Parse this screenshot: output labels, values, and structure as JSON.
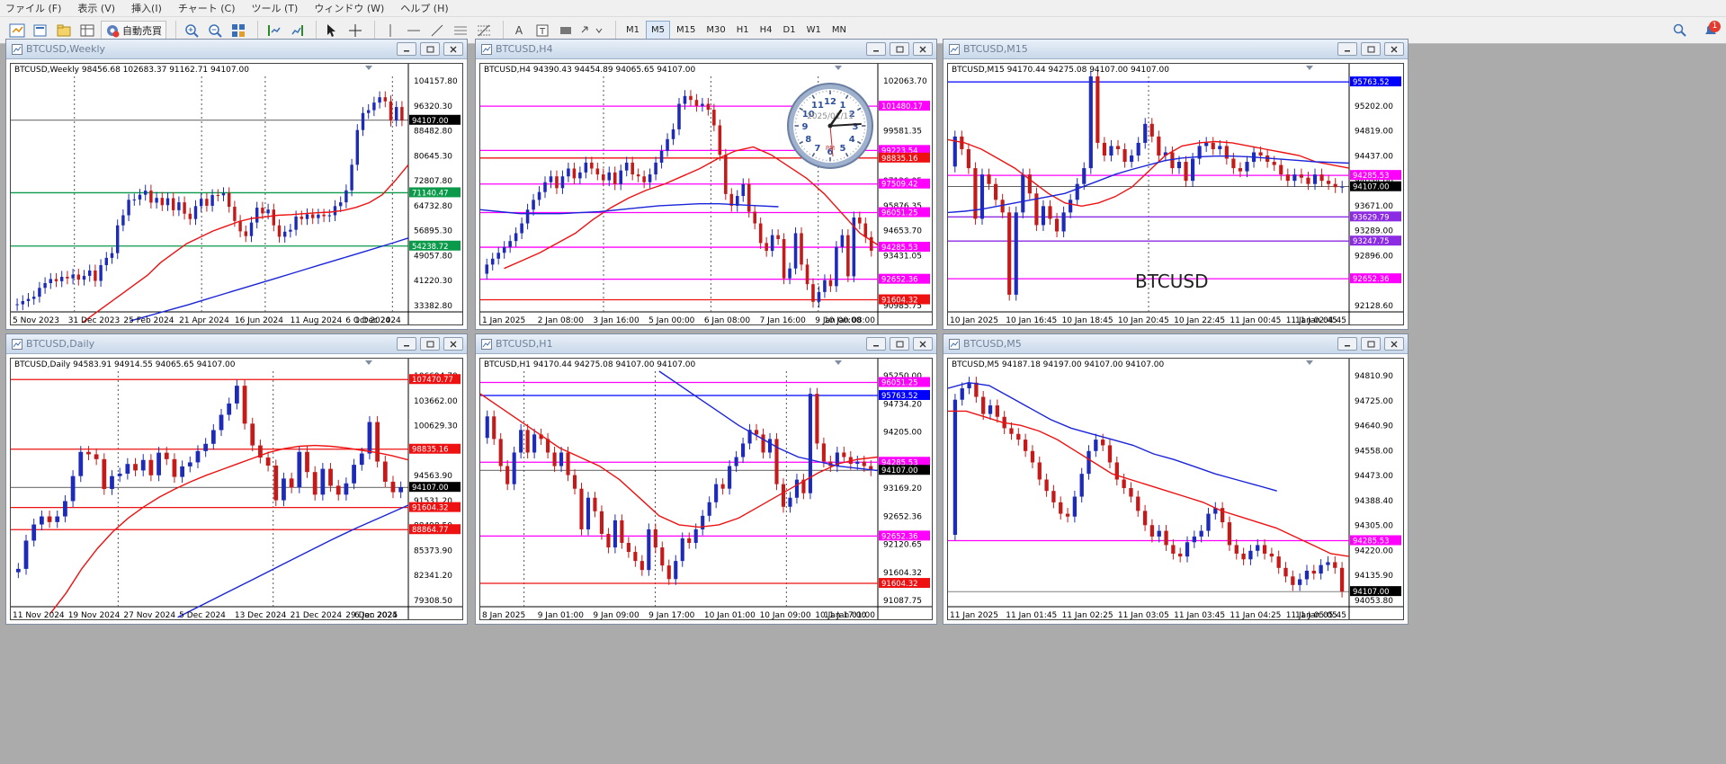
{
  "menu": [
    "ファイル (F)",
    "表示 (V)",
    "挿入(I)",
    "チャート (C)",
    "ツール (T)",
    "ウィンドウ (W)",
    "ヘルプ (H)"
  ],
  "toolbar": {
    "autotrade_label": "自動売買",
    "text_tool_label": "A",
    "timeframes": [
      "M1",
      "M5",
      "M15",
      "M30",
      "H1",
      "H4",
      "D1",
      "W1",
      "MN"
    ],
    "active_timeframe": "M5",
    "notification_count": "1"
  },
  "colors": {
    "bull": "#1d2bb8",
    "bear": "#c41a1a",
    "ma_fast": "#ee1111",
    "ma_slow": "#1a24d9",
    "magenta": "#ff00ff",
    "green": "#0a9a4a",
    "blue": "#0000ff"
  },
  "windows": [
    {
      "id": "w1",
      "title": "BTCUSD,Weekly",
      "info": "BTCUSD,Weekly  98456.68 102683.37 91162.71 94107.00",
      "price_labels": [
        "104157.80",
        "96320.30",
        "88482.80",
        "80645.30",
        "72807.80",
        "64732.80",
        "56895.30",
        "49057.80",
        "41220.30",
        "33382.80"
      ],
      "ymin": 33382.8,
      "ymax": 108000,
      "time_labels": [
        "5 Nov 2023",
        "31 Dec 2023",
        "25 Feb 2024",
        "21 Apr 2024",
        "16 Jun 2024",
        "11 Aug 2024",
        "6 Oct 2024",
        "1 Dec 2024"
      ],
      "vlines": [
        0.16,
        0.48,
        0.64,
        0.96
      ],
      "levels": [
        {
          "value": 94107.0,
          "label": "94107.00",
          "color": "#000000",
          "thin": true
        },
        {
          "value": 71140.47,
          "label": "71140.47",
          "color": "#0a9a4a"
        },
        {
          "value": 54238.72,
          "label": "54238.72",
          "color": "#0a9a4a"
        }
      ],
      "candles": [
        35800,
        36800,
        37500,
        38200,
        41000,
        42500,
        43800,
        43100,
        44500,
        44000,
        45200,
        43600,
        44800,
        46500,
        43200,
        48200,
        50500,
        52000,
        60800,
        64000,
        68900,
        69000,
        70500,
        71800,
        68000,
        69500,
        67200,
        69400,
        65600,
        68100,
        64500,
        62800,
        66900,
        69200,
        67000,
        70400,
        70300,
        71000,
        66700,
        62200,
        58900,
        57400,
        61700,
        66400,
        64600,
        65800,
        60800,
        57200,
        58800,
        59400,
        63600,
        62800,
        64300,
        63100,
        64200,
        63700,
        64000,
        66900,
        68100,
        71900,
        80000,
        91000,
        96400,
        97300,
        99700,
        101400,
        100100,
        94000,
        98300,
        94107
      ],
      "ma_fast": [
        30000,
        33000,
        36000,
        39000,
        42000,
        45000,
        49000,
        52000,
        55000,
        57000,
        59000,
        60500,
        62000,
        63000,
        63500,
        64000,
        64200,
        64500,
        64800,
        65000,
        65500,
        66500,
        68000,
        70500,
        75000,
        80000
      ],
      "ma_slow": [
        30500,
        31800,
        33100,
        34400,
        35700,
        37100,
        38500,
        39900,
        41300,
        42700,
        44100,
        45500,
        46900,
        48300,
        49700,
        51100,
        52500,
        53900,
        55300,
        56800
      ],
      "ma_fast_start": 0.18,
      "ma_slow_start": 0.3
    },
    {
      "id": "w2",
      "title": "BTCUSD,H4",
      "info": "BTCUSD,H4  94390.43 94454.89 94065.65 94107.00",
      "price_labels": [
        "102063.70",
        "100804.00",
        "99581.35",
        "98358.70",
        "97136.05",
        "95876.35",
        "94653.70",
        "93431.05",
        "92208.40",
        "90985.75"
      ],
      "ymin": 90985.75,
      "ymax": 103000,
      "time_labels": [
        "1 Jan 2025",
        "2 Jan 08:00",
        "3 Jan 16:00",
        "5 Jan 00:00",
        "6 Jan 08:00",
        "7 Jan 16:00",
        "9 Jan 00:00",
        "10 Jan 08:00"
      ],
      "vlines": [
        0.31,
        0.58,
        0.85
      ],
      "levels": [
        {
          "value": 101480.17,
          "label": "101480.17",
          "color": "#ff00ff"
        },
        {
          "value": 99223.54,
          "label": "99223.54",
          "color": "#ff00ff"
        },
        {
          "value": 98835.16,
          "label": "98835.16",
          "color": "#ee1111"
        },
        {
          "value": 97509.42,
          "label": "97509.42",
          "color": "#ff00ff"
        },
        {
          "value": 96051.25,
          "label": "96051.25",
          "color": "#ff00ff"
        },
        {
          "value": 94285.53,
          "label": "94285.53",
          "color": "#ff00ff"
        },
        {
          "value": 92652.36,
          "label": "92652.36",
          "color": "#ff00ff"
        },
        {
          "value": 91604.32,
          "label": "91604.32",
          "color": "#ee1111"
        }
      ],
      "candles": [
        93400,
        93700,
        94000,
        94300,
        94600,
        95000,
        95500,
        96200,
        96700,
        97100,
        97600,
        97900,
        97300,
        97900,
        98300,
        97800,
        98100,
        98600,
        98300,
        98000,
        97700,
        98100,
        97500,
        98200,
        98600,
        98000,
        97900,
        97600,
        98000,
        98600,
        99200,
        99800,
        100300,
        101600,
        102000,
        101800,
        101500,
        101600,
        101300,
        100500,
        99000,
        97000,
        96400,
        96900,
        97500,
        96100,
        95500,
        94500,
        94100,
        94900,
        94700,
        92700,
        93200,
        95000,
        93400,
        92400,
        91500,
        92000,
        92600,
        92300,
        94300,
        94900,
        92800,
        95800,
        95500,
        94800,
        94107
      ],
      "ma_fast": [
        93200,
        93600,
        94000,
        94500,
        95000,
        95700,
        96300,
        96800,
        97200,
        97500,
        97900,
        98300,
        98800,
        99200,
        99400,
        99000,
        98400,
        97800,
        97000,
        96000,
        95000,
        94400
      ],
      "ma_slow": [
        96200,
        96100,
        96000,
        96000,
        96000,
        96050,
        96100,
        96200,
        96300,
        96400,
        96450,
        96500,
        96500,
        96450,
        96400,
        96350
      ],
      "ma_fast_start": 0.06,
      "ma_slow_start": 0.0,
      "ma_slow_end": 0.75
    },
    {
      "id": "w3",
      "title": "BTCUSD,M15",
      "info": "BTCUSD,M15  94170.44 94275.08 94107.00 94107.00",
      "price_labels": [
        "95597.00",
        "95202.00",
        "94819.00",
        "94437.00",
        "94054.00",
        "93671.00",
        "93289.00",
        "92896.00",
        "92511.00",
        "92128.60"
      ],
      "ymin": 92128.6,
      "ymax": 95850,
      "time_labels": [
        "10 Jan 2025",
        "10 Jan 16:45",
        "10 Jan 18:45",
        "10 Jan 20:45",
        "10 Jan 22:45",
        "11 Jan 00:45",
        "11 Jan 02:45",
        "11 Jan 04:45"
      ],
      "vlines": [
        0.5
      ],
      "levels": [
        {
          "value": 95763.52,
          "label": "95763.52",
          "color": "#0000ff"
        },
        {
          "value": 94285.53,
          "label": "94285.53",
          "color": "#ff00ff"
        },
        {
          "value": 94107.0,
          "label": "94107.00",
          "color": "#000000",
          "thin": true
        },
        {
          "value": 93629.79,
          "label": "93629.79",
          "color": "#8b2be2"
        },
        {
          "value": 93247.75,
          "label": "93247.75",
          "color": "#8b2be2"
        },
        {
          "value": 92652.36,
          "label": "92652.36",
          "color": "#ff00ff"
        }
      ],
      "symbol": "BTCUSD",
      "candles": [
        94900,
        94700,
        94400,
        93600,
        94300,
        94150,
        93900,
        93700,
        92400,
        93700,
        94300,
        94000,
        93500,
        93800,
        93600,
        93400,
        93700,
        93900,
        94150,
        94400,
        95850,
        94800,
        94600,
        94750,
        94700,
        94500,
        94600,
        94800,
        95100,
        94900,
        94600,
        94650,
        94400,
        94500,
        94200,
        94550,
        94750,
        94800,
        94700,
        94750,
        94550,
        94400,
        94350,
        94500,
        94650,
        94600,
        94500,
        94450,
        94300,
        94200,
        94300,
        94250,
        94150,
        94300,
        94200,
        94150,
        94100,
        94107
      ],
      "ma_fast": [
        94850,
        94800,
        94700,
        94550,
        94400,
        94200,
        94000,
        93850,
        93800,
        93850,
        93950,
        94100,
        94350,
        94600,
        94750,
        94800,
        94820,
        94800,
        94750,
        94700,
        94650,
        94600,
        94500,
        94450,
        94400
      ],
      "ma_slow": [
        93700,
        93720,
        93750,
        93800,
        93850,
        93900,
        93950,
        94000,
        94100,
        94200,
        94300,
        94380,
        94450,
        94520,
        94560,
        94580,
        94590,
        94590,
        94580,
        94560,
        94540,
        94520,
        94500,
        94490,
        94480
      ],
      "ma_fast_start": 0.0,
      "ma_slow_start": 0.0
    },
    {
      "id": "w4",
      "title": "BTCUSD,Daily",
      "info": "BTCUSD,Daily  94583.91 94914.55 94065.65 94107.00",
      "price_labels": [
        "106694.70",
        "103662.00",
        "100629.30",
        "97596.60",
        "94563.90",
        "91531.20",
        "88498.50",
        "85373.90",
        "82341.20",
        "79308.50"
      ],
      "ymin": 79308.5,
      "ymax": 108500,
      "time_labels": [
        "11 Nov 2024",
        "19 Nov 2024",
        "27 Nov 2024",
        "5 Dec 2024",
        "13 Dec 2024",
        "21 Dec 2024",
        "29 Dec 2024",
        "6 Jan 2025"
      ],
      "vlines": [
        0.27,
        0.66
      ],
      "levels": [
        {
          "value": 107470.77,
          "label": "107470.77",
          "color": "#ee1111"
        },
        {
          "value": 98835.16,
          "label": "98835.16",
          "color": "#ee1111"
        },
        {
          "value": 94107.0,
          "label": "94107.00",
          "color": "#000000",
          "thin": true
        },
        {
          "value": 91604.32,
          "label": "91604.32",
          "color": "#ee1111"
        },
        {
          "value": 88864.77,
          "label": "88864.77",
          "color": "#ee1111"
        }
      ],
      "candles": [
        84000,
        87500,
        89500,
        90500,
        89800,
        90500,
        92400,
        95500,
        98500,
        98200,
        97600,
        93900,
        95500,
        95800,
        97000,
        96200,
        97500,
        95600,
        98400,
        97600,
        95400,
        96700,
        97200,
        98600,
        99500,
        101200,
        103100,
        104500,
        106700,
        102000,
        99300,
        97800,
        96800,
        92500,
        95200,
        94100,
        98500,
        96000,
        93200,
        96400,
        94300,
        93200,
        94600,
        96900,
        98300,
        102200,
        97300,
        94800,
        93500,
        94107
      ],
      "ma_fast": [
        78500,
        81000,
        84000,
        86500,
        88600,
        90300,
        91700,
        92900,
        93900,
        94800,
        95600,
        96300,
        97000,
        97700,
        98400,
        98900,
        99200,
        99300,
        99200,
        99000,
        98700,
        98400,
        98000,
        97500
      ],
      "ma_slow": [
        78000,
        79600,
        81200,
        82800,
        84400,
        86000,
        87600,
        89100,
        90500,
        91900
      ],
      "ma_fast_start": 0.1,
      "ma_slow_start": 0.42
    },
    {
      "id": "w5",
      "title": "BTCUSD,H1",
      "info": "BTCUSD,H1  94170.44 94275.08 94107.00 94107.00",
      "price_labels": [
        "95250.00",
        "94734.20",
        "94205.00",
        "93685.65",
        "93169.20",
        "92652.36",
        "92120.65",
        "91604.32",
        "91087.75"
      ],
      "ymin": 91087.75,
      "ymax": 96300,
      "time_labels": [
        "8 Jan 2025",
        "9 Jan 01:00",
        "9 Jan 09:00",
        "9 Jan 17:00",
        "10 Jan 01:00",
        "10 Jan 09:00",
        "10 Jan 17:00",
        "11 Jan 01:00"
      ],
      "vlines": [
        0.11,
        0.44,
        0.77
      ],
      "levels": [
        {
          "value": 96051.25,
          "label": "96051.25",
          "color": "#ff00ff"
        },
        {
          "value": 95763.52,
          "label": "95763.52",
          "color": "#0000ff"
        },
        {
          "value": 94285.53,
          "label": "94285.53",
          "color": "#ff00ff"
        },
        {
          "value": 94107.0,
          "label": "94107.00",
          "color": "#000000",
          "thin": true
        },
        {
          "value": 92652.36,
          "label": "92652.36",
          "color": "#ff00ff"
        },
        {
          "value": 91604.32,
          "label": "91604.32",
          "color": "#ee1111"
        }
      ],
      "candles": [
        95300,
        94800,
        94200,
        93800,
        94500,
        95000,
        94500,
        94900,
        94800,
        94500,
        94200,
        94500,
        94000,
        93700,
        92800,
        93500,
        93200,
        92700,
        92400,
        93000,
        92500,
        92300,
        92100,
        91900,
        92800,
        92400,
        92000,
        91700,
        92100,
        92600,
        92500,
        92800,
        93100,
        93400,
        93800,
        93700,
        94200,
        94400,
        94700,
        95000,
        94900,
        94500,
        94800,
        93800,
        93300,
        93500,
        93900,
        93600,
        95800,
        94700,
        94300,
        94200,
        94500,
        94400,
        94250,
        94300,
        94200,
        94107
      ],
      "ma_fast": [
        95800,
        95500,
        95200,
        94900,
        94600,
        94400,
        94200,
        93900,
        93500,
        93100,
        92900,
        92850,
        92900,
        93050,
        93300,
        93550,
        93800,
        94050,
        94250,
        94350,
        94400
      ],
      "ma_slow": [
        96300,
        96000,
        95700,
        95400,
        95100,
        94850,
        94600,
        94400,
        94300,
        94200,
        94150,
        94100
      ],
      "ma_fast_start": 0.0,
      "ma_slow_start": 0.45
    },
    {
      "id": "w6",
      "title": "BTCUSD,M5",
      "info": "BTCUSD,M5  94187.18 94197.00 94107.00 94107.00",
      "price_labels": [
        "94810.90",
        "94725.00",
        "94640.90",
        "94558.00",
        "94473.00",
        "94388.40",
        "94305.00",
        "94220.00",
        "94135.90",
        "94053.80"
      ],
      "ymin": 94053.8,
      "ymax": 94880,
      "time_labels": [
        "11 Jan 2025",
        "11 Jan 01:45",
        "11 Jan 02:25",
        "11 Jan 03:05",
        "11 Jan 03:45",
        "11 Jan 04:25",
        "11 Jan 05:05",
        "11 Jan 05:45"
      ],
      "vlines": [],
      "levels": [
        {
          "value": 94285.53,
          "label": "94285.53",
          "color": "#ff00ff"
        },
        {
          "value": 94107.0,
          "label": "94107.00",
          "color": "#000000",
          "thin": true
        }
      ],
      "candles": [
        94780,
        94820,
        94840,
        94790,
        94730,
        94760,
        94720,
        94680,
        94660,
        94640,
        94600,
        94560,
        94500,
        94460,
        94420,
        94380,
        94370,
        94440,
        94520,
        94600,
        94640,
        94620,
        94560,
        94500,
        94470,
        94440,
        94390,
        94340,
        94300,
        94320,
        94270,
        94240,
        94230,
        94280,
        94300,
        94320,
        94380,
        94400,
        94350,
        94270,
        94240,
        94220,
        94250,
        94270,
        94240,
        94230,
        94190,
        94160,
        94130,
        94150,
        94180,
        94170,
        94200,
        94210,
        94190,
        94107
      ],
      "ma_fast": [
        94740,
        94740,
        94720,
        94700,
        94690,
        94670,
        94640,
        94600,
        94560,
        94520,
        94500,
        94480,
        94460,
        94440,
        94420,
        94390,
        94370,
        94350,
        94330,
        94300,
        94270,
        94240,
        94230
      ],
      "ma_slow": [
        94820,
        94840,
        94830,
        94790,
        94750,
        94710,
        94680,
        94660,
        94640,
        94620,
        94590,
        94570,
        94545,
        94520,
        94500,
        94480,
        94460
      ],
      "ma_fast_start": 0.0,
      "ma_slow_start": 0.0,
      "ma_slow_end": 0.82
    }
  ],
  "clock": {
    "date": "2025/01/11",
    "period": "PM",
    "numbers": [
      "12",
      "1",
      "2",
      "3",
      "4",
      "5",
      "6",
      "7",
      "8",
      "9",
      "10",
      "11"
    ]
  }
}
